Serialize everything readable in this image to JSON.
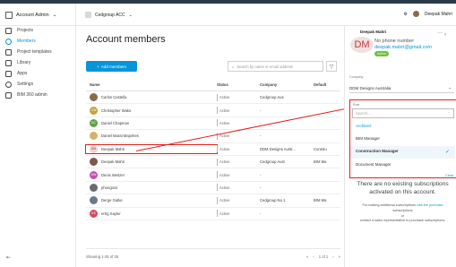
{
  "header": {
    "account_label": "Account Admin",
    "project_label": "Cedgroup ACC",
    "user_name": "Deepak Mahri"
  },
  "sidebar": {
    "items": [
      {
        "label": "Projects",
        "icon": "projects-icon"
      },
      {
        "label": "Members",
        "icon": "members-icon",
        "active": true
      },
      {
        "label": "Project templates",
        "icon": "templates-icon"
      },
      {
        "label": "Library",
        "icon": "library-icon"
      },
      {
        "label": "Apps",
        "icon": "apps-icon"
      },
      {
        "label": "Settings",
        "icon": "settings-icon"
      },
      {
        "label": "BIM 360 admin",
        "icon": "external-link-icon"
      }
    ]
  },
  "main": {
    "title": "Account members",
    "add_button": "Add members",
    "search_placeholder": "Search by name or email address",
    "columns": [
      "Name",
      "Status",
      "Company",
      "Default"
    ],
    "rows": [
      {
        "name": "Carlos Castella",
        "avatar": "",
        "color": "#8a6a4a",
        "status": "Active",
        "company": "Cedgroup Aus",
        "default": ""
      },
      {
        "name": "Christopher Wako",
        "avatar": "CW",
        "color": "#c9a03a",
        "status": "Active",
        "company": "-",
        "default": ""
      },
      {
        "name": "Daniel Chapman",
        "avatar": "DC",
        "color": "#5ea04a",
        "status": "Active",
        "company": "-",
        "default": ""
      },
      {
        "name": "Daniel Marat Majorkes",
        "avatar": "",
        "color": "#d6b36a",
        "status": "Active",
        "company": "-",
        "default": ""
      },
      {
        "name": "Deepak Mahri",
        "avatar": "DM",
        "color": "#f3d2d2",
        "status": "Active",
        "company": "DDM Designs Austr...",
        "default": "Constru",
        "highlight": true
      },
      {
        "name": "Deepak Mahri",
        "avatar": "",
        "color": "#7a5a4a",
        "status": "Active",
        "company": "Cedgroup Aust",
        "default": "BIM Ma"
      },
      {
        "name": "Denis Weitzer",
        "avatar": "DW",
        "color": "#c64fb6",
        "status": "Active",
        "company": "-",
        "default": ""
      },
      {
        "name": "phongoxs",
        "avatar": "",
        "color": "#6a6a6a",
        "status": "Active",
        "company": "-",
        "default": ""
      },
      {
        "name": "Derge Gatke",
        "avatar": "",
        "color": "#6a7a8a",
        "status": "Active",
        "company": "Cedgroup Nu 1",
        "default": "BIM Ma"
      },
      {
        "name": "ertrg Sayler",
        "avatar": "ES",
        "color": "#d44b62",
        "status": "Active",
        "company": "-",
        "default": ""
      }
    ],
    "footer_count": "Showing 1-25 of 35",
    "pager": {
      "prev2": "«",
      "prev": "‹",
      "page": "1 of 1",
      "next": "›",
      "next2": "»"
    }
  },
  "panel": {
    "name": "Deepak Mahri",
    "initials": "DM",
    "phone": "No phone number",
    "email": "deepak.mahri@gmail.com",
    "status": "Active",
    "company_label": "Company",
    "company": "DDM Designs Australia",
    "role_label": "Role",
    "role_placeholder": "Search...",
    "roles": [
      "Architect",
      "BIM Manager",
      "Construction Manager",
      "Document Manager"
    ],
    "selected_role": "Construction Manager",
    "clear_label": "Clear",
    "message": "There are no existing subscriptions activated on this account.",
    "sub_line1_pre": "For making additional subscriptions",
    "sub_link": "visit the purchase",
    "sub_line2": "subscriptions",
    "sub_or": "or",
    "sub_line3": "contact a sales representative to purchase subscriptions."
  },
  "colors": {
    "accent": "#0696d7",
    "highlight": "#e0201c",
    "active_badge": "#6fbf3f"
  }
}
